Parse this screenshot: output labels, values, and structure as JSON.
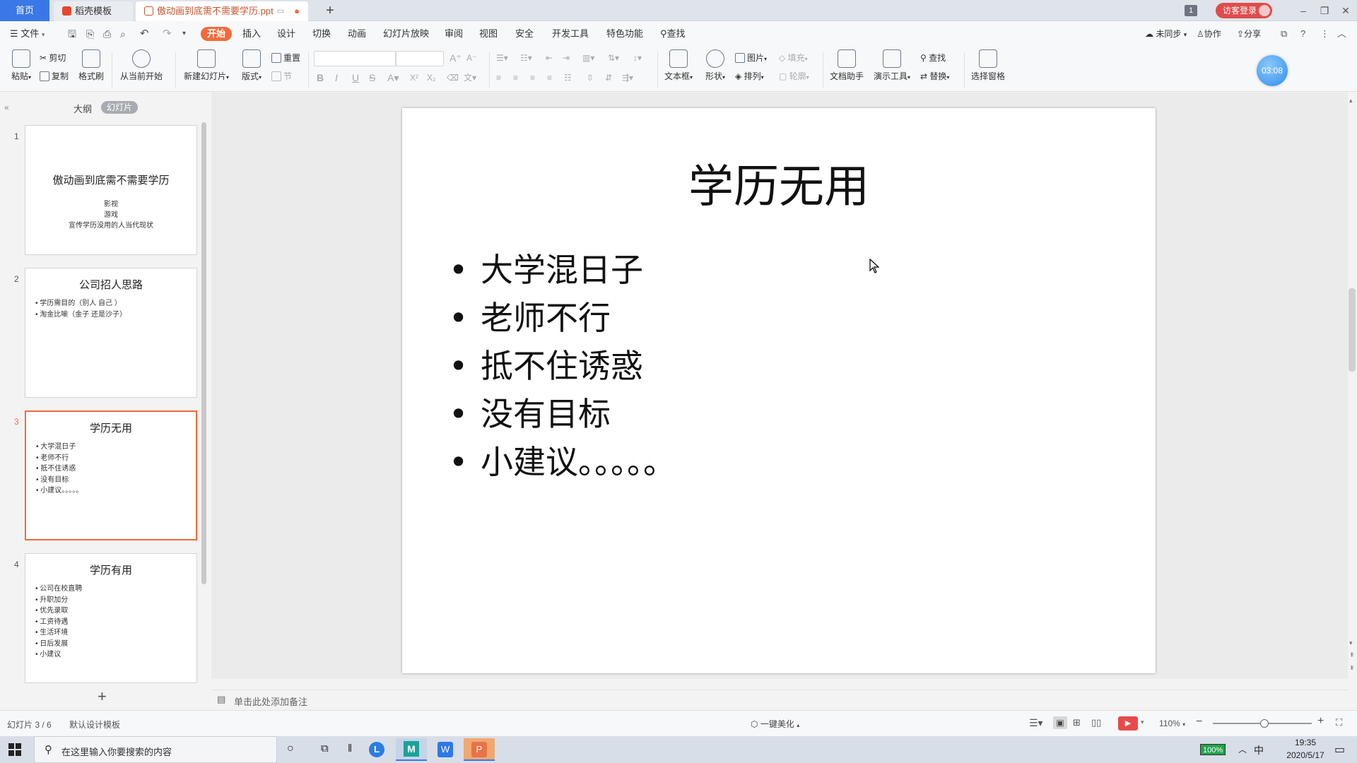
{
  "tabs": {
    "home": "首页",
    "template": "稻壳模板",
    "document": "傲动画到底需不需要学历.ppt"
  },
  "titlebar": {
    "badge": "1",
    "login": "访客登录"
  },
  "menu": {
    "file": "文件",
    "items": [
      "开始",
      "插入",
      "设计",
      "切换",
      "动画",
      "幻灯片放映",
      "审阅",
      "视图",
      "安全",
      "开发工具",
      "特色功能"
    ],
    "search": "查找",
    "sync": "未同步",
    "collab": "协作",
    "share": "分享"
  },
  "ribbon": {
    "paste": "粘贴",
    "cut": "剪切",
    "copy": "复制",
    "format_painter": "格式刷",
    "from_current": "从当前开始",
    "new_slide": "新建幻灯片",
    "layout": "版式",
    "reset": "重置",
    "section": "节",
    "textbox": "文本框",
    "shape": "形状",
    "picture": "图片",
    "fill": "填充",
    "arrange": "排列",
    "outline": "轮廓",
    "doc_assistant": "文档助手",
    "present_tools": "演示工具",
    "find": "查找",
    "replace": "替换",
    "select_pane": "选择窗格",
    "timer": "03:08"
  },
  "panel": {
    "outline_tab": "大纲",
    "slides_tab": "幻灯片"
  },
  "thumbnails": [
    {
      "num": "1",
      "title": "傲动画到底需不需要学历",
      "lines": [
        "影视",
        "游戏",
        "宣传学历没用的人当代现状"
      ]
    },
    {
      "num": "2",
      "title": "公司招人思路",
      "bullets": [
        "学历需目的（别人 自己 ）",
        "淘金比喻（金子 还是沙子）"
      ]
    },
    {
      "num": "3",
      "title": "学历无用",
      "bullets": [
        "大学混日子",
        "老师不行",
        "抵不住诱惑",
        "没有目标",
        "小建议。。。。。"
      ]
    },
    {
      "num": "4",
      "title": "学历有用",
      "bullets": [
        "公司在校直聘",
        "升职加分",
        "优先录取",
        "工资待遇",
        "生活环境",
        "日后发展",
        "小建议"
      ]
    }
  ],
  "slide": {
    "title": "学历无用",
    "bullets": [
      "大学混日子",
      "老师不行",
      "抵不住诱惑",
      "没有目标",
      "小建议。。。。。"
    ]
  },
  "notes": {
    "placeholder": "单击此处添加备注"
  },
  "status": {
    "slide_count": "幻灯片 3 / 6",
    "template": "默认设计模板",
    "beautify": "一键美化",
    "zoom": "110%",
    "zoom_level": 0.52
  },
  "taskbar": {
    "search_placeholder": "在这里输入你要搜索的内容",
    "battery": "100%",
    "ime": "中",
    "time": "19:35",
    "date": "2020/5/17"
  }
}
